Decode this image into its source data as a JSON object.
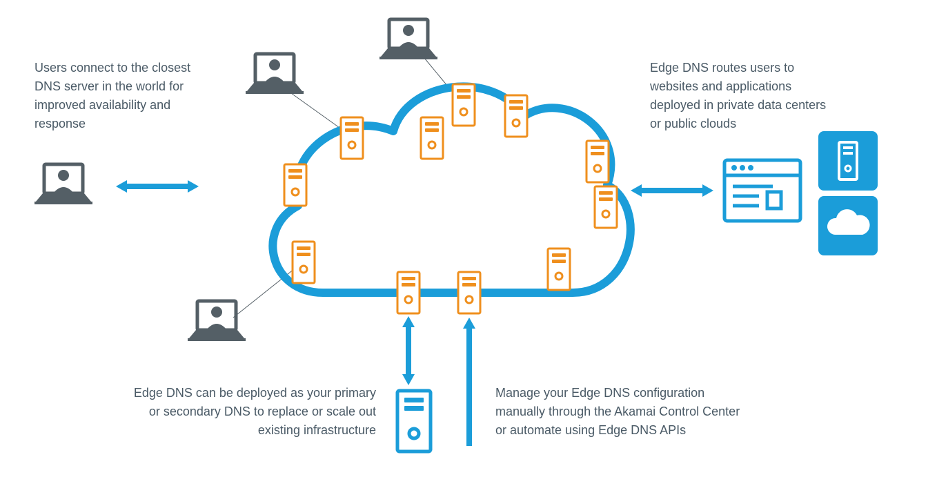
{
  "diagram": {
    "topLeft": "Users connect to the closest DNS server in the world for improved availability and response",
    "topRight": "Edge DNS routes users to websites and applications deployed in private data centers or public clouds",
    "bottomLeft": "Edge DNS can be deployed as your primary or secondary DNS to replace or scale out existing infrastructure",
    "bottomRight": "Manage your Edge DNS configuration manually through the Akamai Control Center or automate using Edge DNS APIs"
  },
  "colors": {
    "blue": "#1b9dd9",
    "orange": "#ef8f1d",
    "gray": "#545f66",
    "text": "#4a5a66"
  }
}
